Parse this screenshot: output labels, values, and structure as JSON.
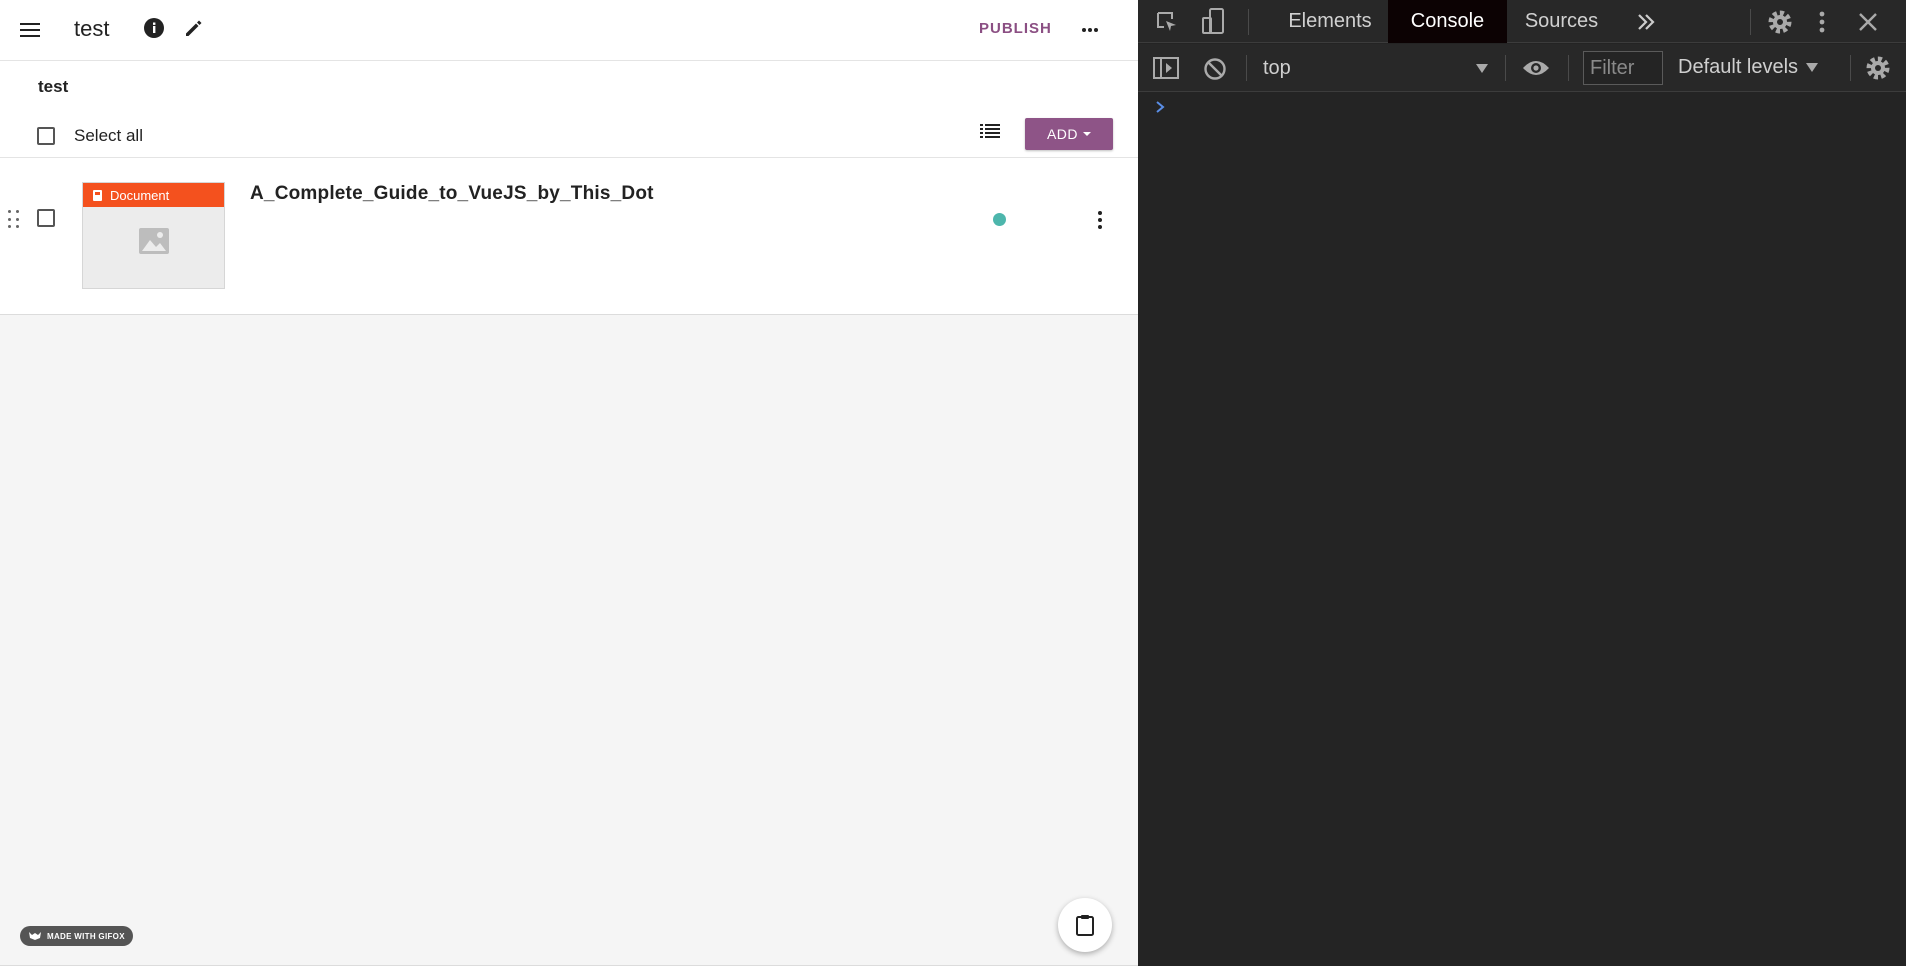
{
  "toolbar": {
    "title": "test",
    "publish_label": "PUBLISH"
  },
  "subheader": {
    "channel_title": "test",
    "select_all_label": "Select all",
    "add_label": "ADD"
  },
  "resources": [
    {
      "kind_label": "Document",
      "title": "A_Complete_Guide_to_VueJS_by_This_Dot",
      "status_color": "#4db6ac"
    }
  ],
  "badge": {
    "gifox_label": "MADE WITH GIFOX"
  },
  "devtools": {
    "tabs": [
      "Elements",
      "Console",
      "Sources"
    ],
    "active_tab": "Console",
    "context": "top",
    "filter_placeholder": "Filter",
    "levels_label": "Default levels"
  },
  "colors": {
    "accent": "#8e5487",
    "document": "#f4511e",
    "status": "#4db6ac"
  }
}
